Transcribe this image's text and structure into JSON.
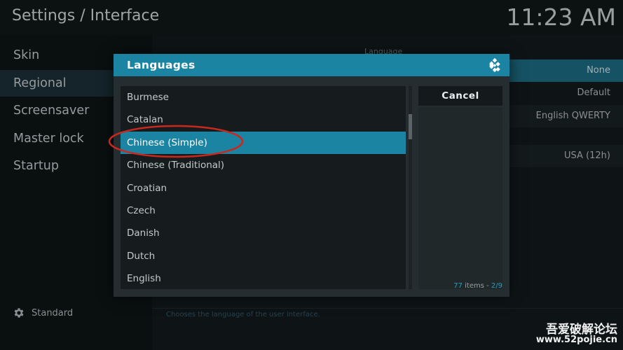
{
  "header": {
    "title": "Settings / Interface",
    "clock": "11:23 AM"
  },
  "sidebar": {
    "items": [
      {
        "label": "Skin"
      },
      {
        "label": "Regional"
      },
      {
        "label": "Screensaver"
      },
      {
        "label": "Master lock"
      },
      {
        "label": "Startup"
      }
    ],
    "active_index": 1,
    "settings_level": {
      "label": "Standard",
      "icon": "gear-icon"
    }
  },
  "background_settings": {
    "section_label": "Language",
    "values": [
      "None",
      "Default",
      "English QWERTY",
      "USA (12h)"
    ]
  },
  "hint": "Chooses the language of the user interface.",
  "dialog": {
    "title": "Languages",
    "logo_icon": "kodi-logo-icon",
    "items": [
      {
        "label": "Burmese"
      },
      {
        "label": "Catalan"
      },
      {
        "label": "Chinese (Simple)"
      },
      {
        "label": "Chinese (Traditional)"
      },
      {
        "label": "Croatian"
      },
      {
        "label": "Czech"
      },
      {
        "label": "Danish"
      },
      {
        "label": "Dutch"
      },
      {
        "label": "English"
      }
    ],
    "selected_index": 2,
    "cancel_label": "Cancel",
    "item_count": {
      "total": "77",
      "word": "items",
      "separator": " - ",
      "page": "2/9"
    }
  },
  "annotation": {
    "shape": "red-ellipse",
    "color": "#c8281e"
  },
  "watermark": {
    "title": "吾爱破解论坛",
    "url": "www.52pojie.cn"
  },
  "colors": {
    "accent": "#1c84a3",
    "background": "#101719",
    "dialog": "#262d30",
    "annotation_red": "#c8281e"
  }
}
